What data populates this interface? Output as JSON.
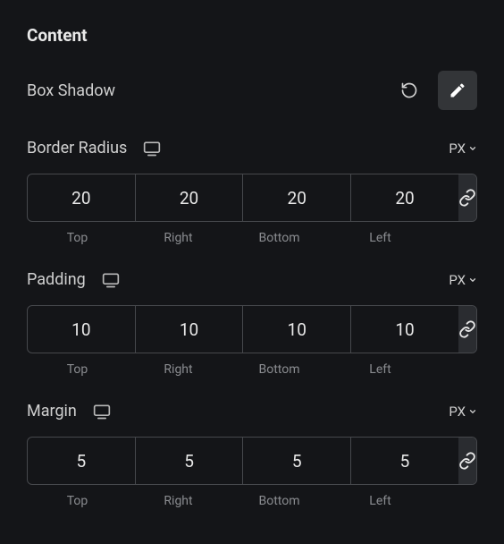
{
  "section_title": "Content",
  "box_shadow": {
    "label": "Box Shadow"
  },
  "border_radius": {
    "label": "Border Radius",
    "unit": "PX",
    "top": "20",
    "right": "20",
    "bottom": "20",
    "left": "20",
    "labels": {
      "top": "Top",
      "right": "Right",
      "bottom": "Bottom",
      "left": "Left"
    }
  },
  "padding": {
    "label": "Padding",
    "unit": "PX",
    "top": "10",
    "right": "10",
    "bottom": "10",
    "left": "10",
    "labels": {
      "top": "Top",
      "right": "Right",
      "bottom": "Bottom",
      "left": "Left"
    }
  },
  "margin": {
    "label": "Margin",
    "unit": "PX",
    "top": "5",
    "right": "5",
    "bottom": "5",
    "left": "5",
    "labels": {
      "top": "Top",
      "right": "Right",
      "bottom": "Bottom",
      "left": "Left"
    }
  }
}
